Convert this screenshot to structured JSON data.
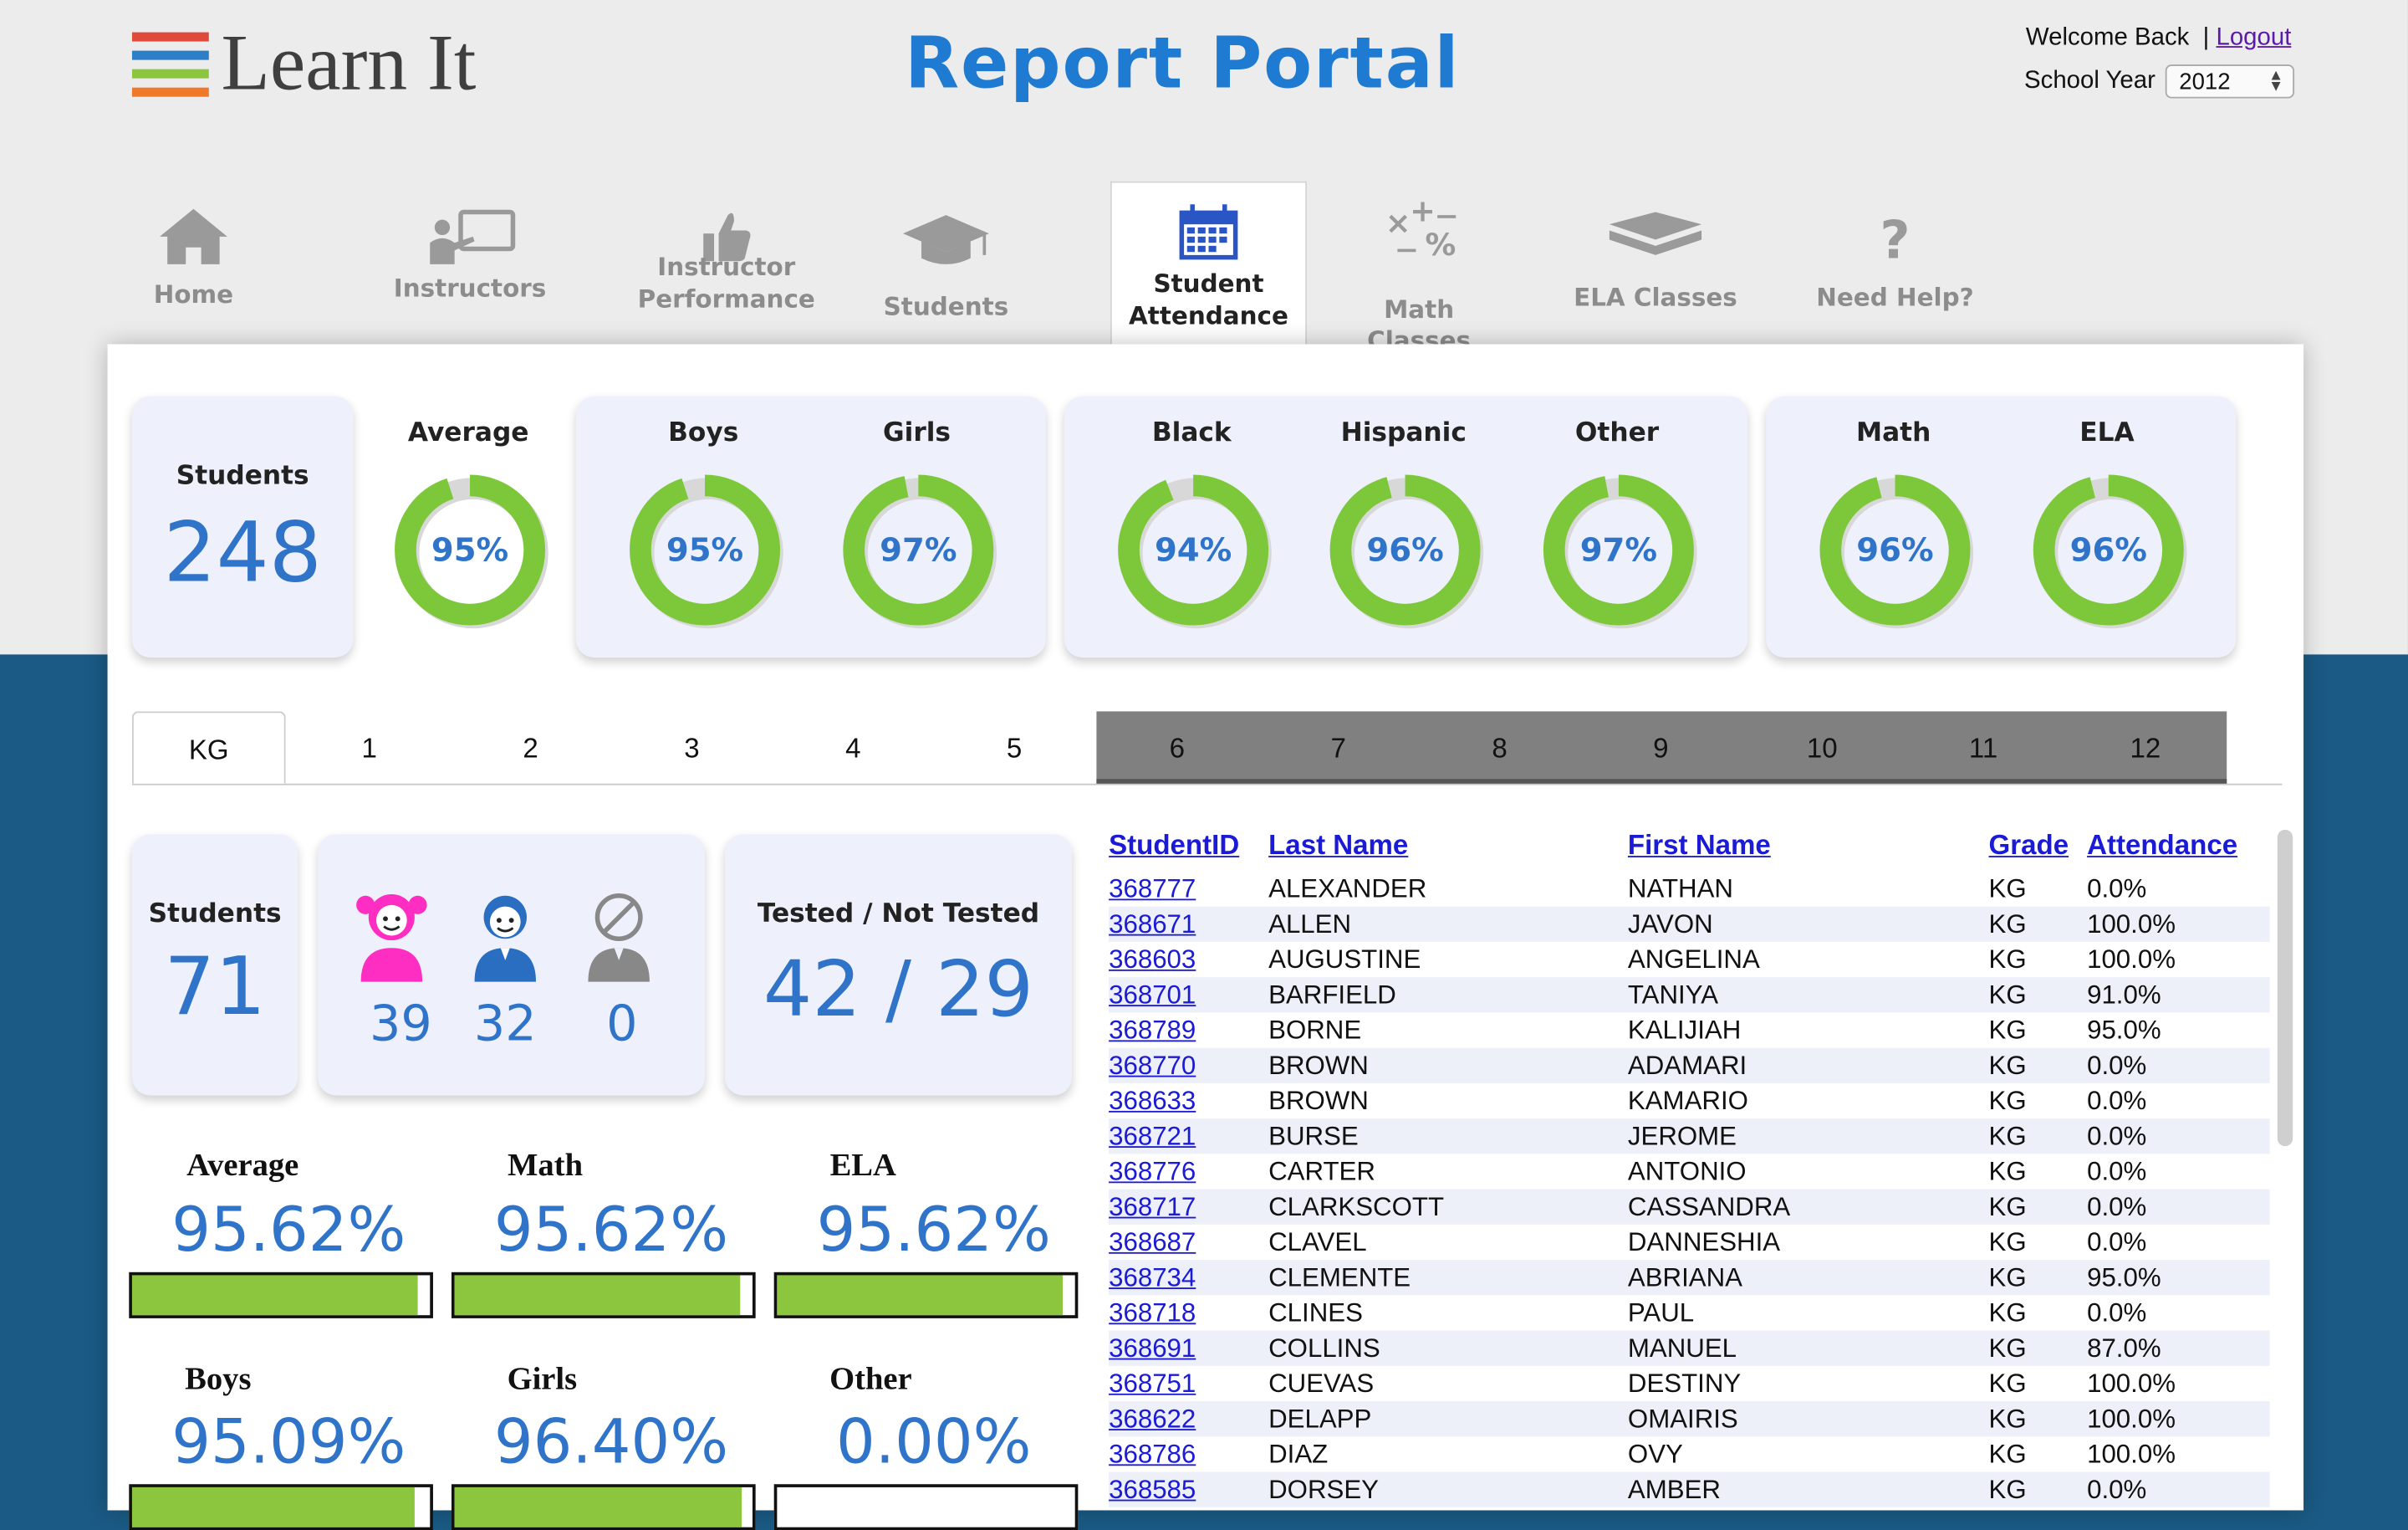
{
  "header": {
    "logo_text": "Learn It",
    "title": "Report Portal",
    "welcome": "Welcome Back",
    "logout": "Logout",
    "school_year_label": "School Year",
    "school_year_value": "2012",
    "logo_colors": [
      "#e04a3b",
      "#2c7fc7",
      "#8cc63f",
      "#f0782a"
    ]
  },
  "nav": [
    {
      "label1": "Home",
      "label2": "",
      "icon": "home-icon"
    },
    {
      "label1": "Instructors",
      "label2": "",
      "icon": "instructor-icon"
    },
    {
      "label1": "Instructor",
      "label2": "Performance",
      "icon": "thumbs-up-icon"
    },
    {
      "label1": "Students",
      "label2": "",
      "icon": "graduation-cap-icon"
    },
    {
      "label1": "Student",
      "label2": "Attendance",
      "icon": "calendar-icon",
      "active": true
    },
    {
      "label1": "Math Classes",
      "label2": "",
      "icon": "math-symbols-icon"
    },
    {
      "label1": "ELA Classes",
      "label2": "",
      "icon": "books-icon"
    },
    {
      "label1": "Need Help?",
      "label2": "",
      "icon": "question-icon"
    }
  ],
  "summary": {
    "students_label": "Students",
    "students_value": "248",
    "rings": [
      {
        "label": "Average",
        "value": 95,
        "text": "95%"
      },
      {
        "label": "Boys",
        "value": 95,
        "text": "95%"
      },
      {
        "label": "Girls",
        "value": 97,
        "text": "97%"
      },
      {
        "label": "Black",
        "value": 94,
        "text": "94%"
      },
      {
        "label": "Hispanic",
        "value": 96,
        "text": "96%"
      },
      {
        "label": "Other",
        "value": 97,
        "text": "97%"
      },
      {
        "label": "Math",
        "value": 96,
        "text": "96%"
      },
      {
        "label": "ELA",
        "value": 96,
        "text": "96%"
      }
    ],
    "ring_color": "#7dc83a"
  },
  "grades": [
    "KG",
    "1",
    "2",
    "3",
    "4",
    "5",
    "6",
    "7",
    "8",
    "9",
    "10",
    "11",
    "12"
  ],
  "active_grade": "KG",
  "grade_stats": {
    "students_label": "Students",
    "students_value": "71",
    "girls_count": "39",
    "boys_count": "32",
    "unknown_count": "0",
    "tested_label": "Tested / Not Tested",
    "tested_value": "42 / 29"
  },
  "bars": [
    {
      "label": "Average",
      "text": "95.62%",
      "value": 95.62
    },
    {
      "label": "Math",
      "text": "95.62%",
      "value": 95.62
    },
    {
      "label": "ELA",
      "text": "95.62%",
      "value": 95.62
    },
    {
      "label": "Boys",
      "text": "95.09%",
      "value": 95.09
    },
    {
      "label": "Girls",
      "text": "96.40%",
      "value": 96.4
    },
    {
      "label": "Other",
      "text": "0.00%",
      "value": 0
    }
  ],
  "table": {
    "headers": [
      "StudentID",
      "Last Name",
      "First Name",
      "Grade",
      "Attendance"
    ],
    "rows": [
      [
        "368777",
        "ALEXANDER",
        "NATHAN",
        "KG",
        "0.0%"
      ],
      [
        "368671",
        "ALLEN",
        "JAVON",
        "KG",
        "100.0%"
      ],
      [
        "368603",
        "AUGUSTINE",
        "ANGELINA",
        "KG",
        "100.0%"
      ],
      [
        "368701",
        "BARFIELD",
        "TANIYA",
        "KG",
        "91.0%"
      ],
      [
        "368789",
        "BORNE",
        "KALIJIAH",
        "KG",
        "95.0%"
      ],
      [
        "368770",
        "BROWN",
        "ADAMARI",
        "KG",
        "0.0%"
      ],
      [
        "368633",
        "BROWN",
        "KAMARIO",
        "KG",
        "0.0%"
      ],
      [
        "368721",
        "BURSE",
        "JEROME",
        "KG",
        "0.0%"
      ],
      [
        "368776",
        "CARTER",
        "ANTONIO",
        "KG",
        "0.0%"
      ],
      [
        "368717",
        "CLARKSCOTT",
        "CASSANDRA",
        "KG",
        "0.0%"
      ],
      [
        "368687",
        "CLAVEL",
        "DANNESHIA",
        "KG",
        "0.0%"
      ],
      [
        "368734",
        "CLEMENTE",
        "ABRIANA",
        "KG",
        "95.0%"
      ],
      [
        "368718",
        "CLINES",
        "PAUL",
        "KG",
        "0.0%"
      ],
      [
        "368691",
        "COLLINS",
        "MANUEL",
        "KG",
        "87.0%"
      ],
      [
        "368751",
        "CUEVAS",
        "DESTINY",
        "KG",
        "100.0%"
      ],
      [
        "368622",
        "DELAPP",
        "OMAIRIS",
        "KG",
        "100.0%"
      ],
      [
        "368786",
        "DIAZ",
        "OVY",
        "KG",
        "100.0%"
      ],
      [
        "368585",
        "DORSEY",
        "AMBER",
        "KG",
        "0.0%"
      ]
    ]
  }
}
